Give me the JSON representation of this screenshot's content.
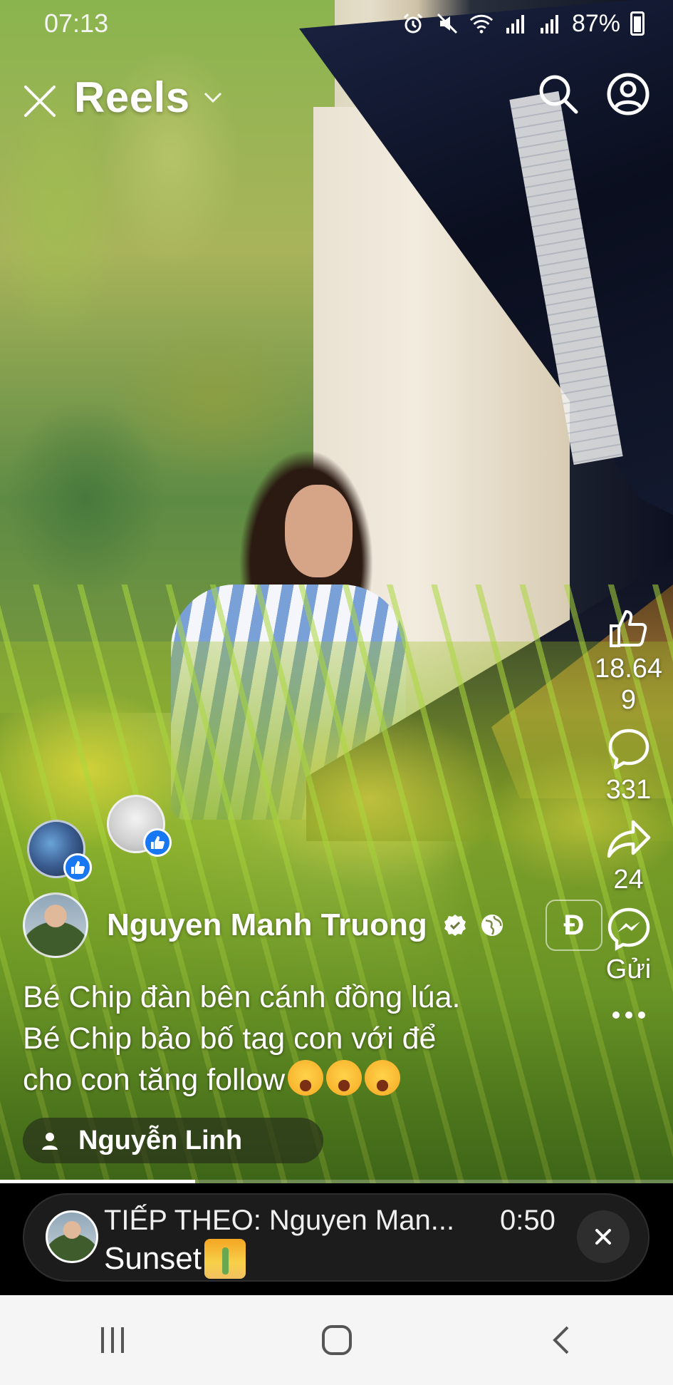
{
  "status_bar": {
    "time": "07:13",
    "battery_percent": "87%"
  },
  "header": {
    "title": "Reels"
  },
  "actions": {
    "like_count": "18.649",
    "like_count_line1": "18.64",
    "like_count_line2": "9",
    "comment_count": "331",
    "share_count": "24",
    "send_label": "Gửi"
  },
  "author": {
    "name": "Nguyen Manh Truong",
    "follow_chip": "Đ"
  },
  "caption": {
    "line1": "Bé Chip đàn bên cánh đồng lúa.",
    "line2": "Bé Chip bảo bố tag con với để",
    "line3": "cho con tăng follow"
  },
  "tag": {
    "person": "Nguyễn Linh"
  },
  "progress": {
    "fraction": 0.29
  },
  "next_up": {
    "title": "TIẾP THEO: Nguyen Man...",
    "duration": "0:50",
    "song": "Sunset"
  },
  "colors": {
    "like_badge": "#1877f2",
    "panel_bg": "#1c1c1c",
    "nav_bg": "#f5f5f5"
  }
}
